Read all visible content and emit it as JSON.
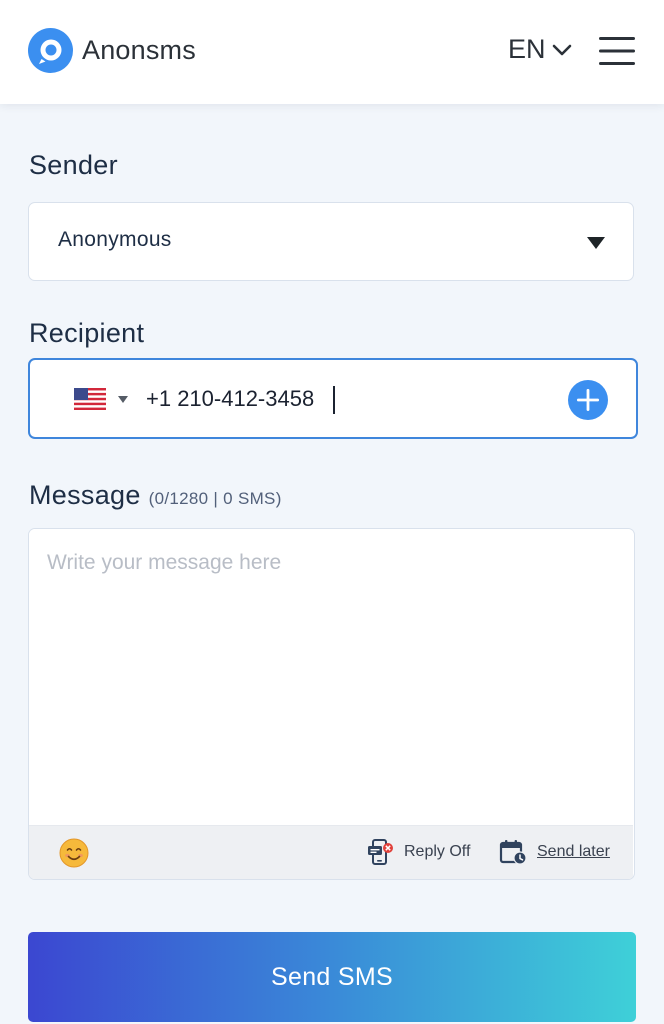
{
  "header": {
    "brand": "Anonsms",
    "language": "EN",
    "icons": {
      "logo": "anonsms-logo-icon",
      "lang_caret": "chevron-down-icon",
      "menu": "hamburger-menu-icon"
    }
  },
  "sender": {
    "label": "Sender",
    "selected": "Anonymous",
    "icon": "caret-down-icon"
  },
  "recipient": {
    "label": "Recipient",
    "country_flag": "us-flag-icon",
    "phone_value": "+1 210-412-3458",
    "add_icon": "plus-circle-icon"
  },
  "message": {
    "label": "Message",
    "counter": "(0/1280 | 0 SMS)",
    "placeholder": "Write your message here",
    "value": "",
    "toolbar": {
      "emoji_icon": "smiley-emoji-icon",
      "reply_label": "Reply Off",
      "reply_icon": "reply-off-icon",
      "send_later_label": "Send later",
      "send_later_icon": "calendar-clock-icon"
    }
  },
  "actions": {
    "send_label": "Send SMS"
  },
  "colors": {
    "accent_blue": "#3b8ff0",
    "focus_border": "#3f86dc",
    "page_bg": "#f2f6fb",
    "gradient_start": "#3b47d1",
    "gradient_end": "#3ed0d8"
  }
}
